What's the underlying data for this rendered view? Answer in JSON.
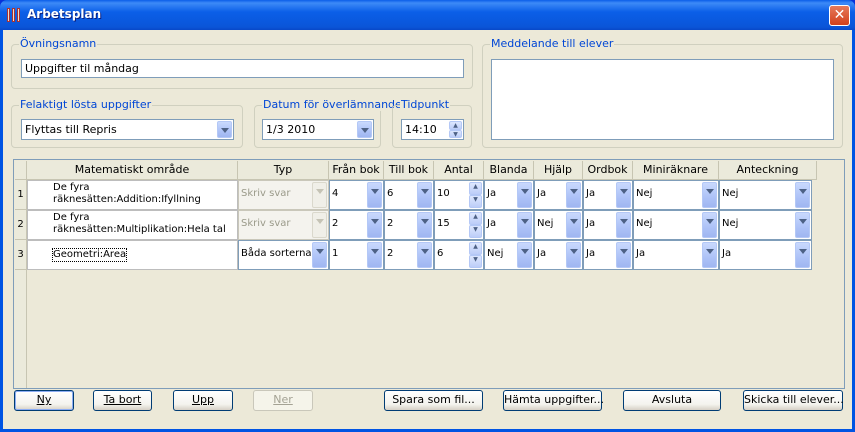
{
  "window": {
    "title": "Arbetsplan",
    "close_glyph": "✕"
  },
  "exercise": {
    "label": "Övningsnamn",
    "value": "Uppgifter til måndag"
  },
  "message": {
    "label": "Meddelande till elever",
    "value": ""
  },
  "wrong_tasks": {
    "label": "Felaktigt lösta uppgifter",
    "value": "Flyttas till Repris"
  },
  "due_date": {
    "label": "Datum för överlämnande",
    "value": "1/3 2010"
  },
  "time": {
    "label": "Tidpunkt",
    "value": "14:10"
  },
  "table": {
    "columns": [
      "Matematiskt område",
      "Typ",
      "Från bok",
      "Till bok",
      "Antal",
      "Blanda",
      "Hjälp",
      "Ordbok",
      "Miniräknare",
      "Anteckning"
    ],
    "rows": [
      {
        "num": "1",
        "area_line1": "De fyra",
        "area_line2": "räknesätten:Addition:Ifyllning",
        "typ": "Skriv svar",
        "fran": "4",
        "till": "6",
        "antal": "10",
        "blanda": "Ja",
        "hjalp": "Ja",
        "ordbok": "Ja",
        "mini": "Nej",
        "antk": "Nej"
      },
      {
        "num": "2",
        "area_line1": "De fyra",
        "area_line2": "räknesätten:Multiplikation:Hela tal",
        "typ": "Skriv svar",
        "fran": "2",
        "till": "2",
        "antal": "15",
        "blanda": "Ja",
        "hjalp": "Nej",
        "ordbok": "Ja",
        "mini": "Nej",
        "antk": "Nej"
      },
      {
        "num": "3",
        "area_line1": "Geometri:Area",
        "area_line2": "",
        "typ": "Båda sorterna",
        "fran": "1",
        "till": "2",
        "antal": "6",
        "blanda": "Nej",
        "hjalp": "Ja",
        "ordbok": "Ja",
        "mini": "Ja",
        "antk": "Ja"
      }
    ]
  },
  "buttons": {
    "ny": "Ny",
    "ta_bort": "Ta bort",
    "upp": "Upp",
    "ner": "Ner",
    "spara": "Spara som fil...",
    "hamta": "Hämta uppgifter...",
    "avsluta": "Avsluta",
    "skicka": "Skicka till elever..."
  },
  "colors": {
    "title_bar": "#0054e3",
    "group_label": "#0046d5",
    "close": "#d2401c",
    "dialog_bg": "#ece9d8"
  }
}
